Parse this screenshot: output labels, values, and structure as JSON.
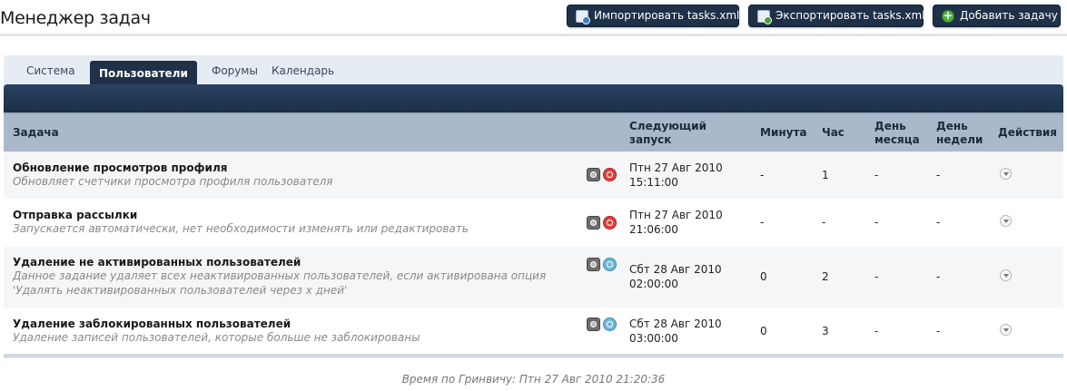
{
  "header": {
    "title": "Менеджер задач",
    "buttons": {
      "import_label": "Импортировать tasks.xml",
      "export_label": "Экспортировать tasks.xml",
      "add_label": "Добавить задачу"
    }
  },
  "tabs": [
    {
      "label": "Система"
    },
    {
      "label": "Пользователи"
    },
    {
      "label": "Форумы"
    },
    {
      "label": "Календарь"
    }
  ],
  "active_tab": "Пользователи",
  "table": {
    "headers": {
      "task": "Задача",
      "next_run_line1": "Следующий",
      "next_run_line2": "запуск",
      "minute": "Минута",
      "hour": "Час",
      "day_of_month_line1": "День",
      "day_of_month_line2": "месяца",
      "weekday_line1": "День",
      "weekday_line2": "недели",
      "actions": "Действия"
    },
    "rows": [
      {
        "name": "Обновление просмотров профиля",
        "description": "Обновляет счетчики просмотра профиля пользователя",
        "next_date": "Птн 27 Авг 2010",
        "next_time": "15:11:00",
        "minute": "-",
        "hour": "1",
        "day_of_month": "-",
        "weekday": "-",
        "enabled": false
      },
      {
        "name": "Отправка рассылки",
        "description": "Запускается автоматически, нет необходимости изменять или редактировать",
        "next_date": "Птн 27 Авг 2010",
        "next_time": "21:06:00",
        "minute": "-",
        "hour": "-",
        "day_of_month": "-",
        "weekday": "-",
        "enabled": false
      },
      {
        "name": "Удаление не активированных пользователей",
        "description": "Данное задание удаляет всех неактивированных пользователей, если активирована опция 'Удалять неактивированных пользователей через x дней'",
        "next_date": "Сбт 28 Авг 2010",
        "next_time": "02:00:00",
        "minute": "0",
        "hour": "2",
        "day_of_month": "-",
        "weekday": "-",
        "enabled": true
      },
      {
        "name": "Удаление заблокированных пользователей",
        "description": "Удаление записей пользователей, которые больше не заблокированы",
        "next_date": "Сбт 28 Авг 2010",
        "next_time": "03:00:00",
        "minute": "0",
        "hour": "3",
        "day_of_month": "-",
        "weekday": "-",
        "enabled": true
      }
    ]
  },
  "footer": {
    "gmt_time": "Время по Гринвичу: Птн 27 Авг 2010 21:20:36"
  },
  "colors": {
    "dark_navy": "#1e3148",
    "header_row": "#a9b9cb",
    "panel_bg": "#e6ecf3",
    "disabled_icon": "#e14141",
    "enabled_icon": "#6fb9d8"
  },
  "icons": {
    "import": "import-document-icon",
    "export": "export-document-icon",
    "add": "add-plus-icon",
    "schedule": "clock-icon",
    "state": "toggle-state-icon",
    "actions": "chevron-down-icon"
  }
}
